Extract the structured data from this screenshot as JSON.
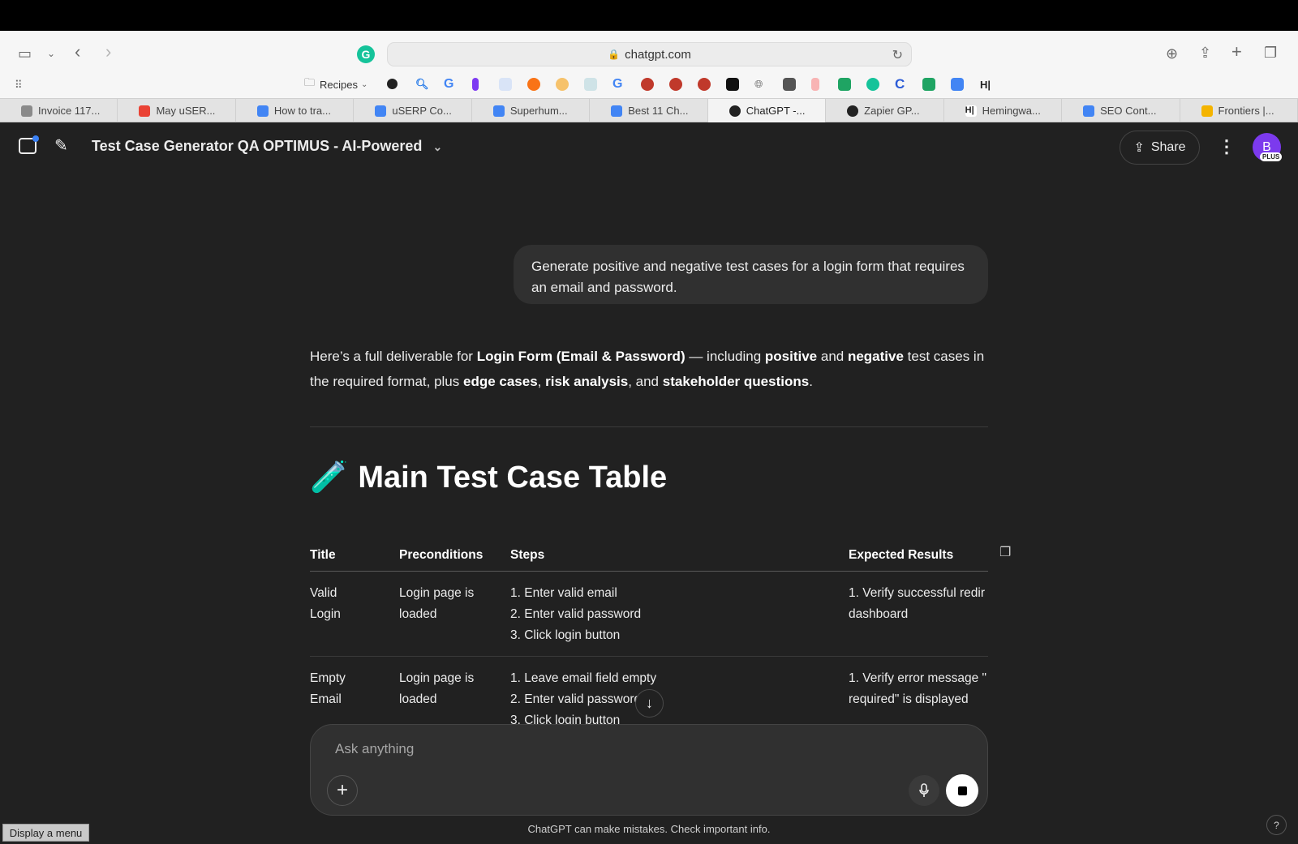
{
  "browser": {
    "url": "chatgpt.com",
    "bookmarks_folder": "Recipes",
    "tabs": [
      {
        "label": "Invoice 117...",
        "color": "#8a8a8a"
      },
      {
        "label": "May uSER...",
        "color": "#ea4335"
      },
      {
        "label": "How to tra...",
        "color": "#4285f4"
      },
      {
        "label": "uSERP Co...",
        "color": "#4285f4"
      },
      {
        "label": "Superhum...",
        "color": "#4285f4"
      },
      {
        "label": "Best 11 Ch...",
        "color": "#4285f4"
      },
      {
        "label": "ChatGPT -...",
        "color": "#222222"
      },
      {
        "label": "Zapier GP...",
        "color": "#222222"
      },
      {
        "label": "Hemingwa...",
        "color": "#222222"
      },
      {
        "label": "SEO Cont...",
        "color": "#4285f4"
      },
      {
        "label": "Frontiers |...",
        "color": "#f4b400"
      }
    ]
  },
  "header": {
    "title": "Test Case Generator QA OPTIMUS - AI-Powered",
    "share_label": "Share",
    "avatar_initial": "B",
    "plan_badge": "PLUS"
  },
  "conversation": {
    "user_message": "Generate positive and negative test cases for a login form that requires an email and password.",
    "intro": {
      "p1": "Here’s a full deliverable for ",
      "b1": "Login Form (Email & Password)",
      "p2": " — including ",
      "b2": "positive",
      "p3": " and ",
      "b3": "negative",
      "p4": " test cases in the required format, plus ",
      "b4": "edge cases",
      "p5": ", ",
      "b5": "risk analysis",
      "p6": ", and ",
      "b6": "stakeholder questions",
      "p7": "."
    },
    "section_emoji": "🧪",
    "section_title": "Main Test Case Table",
    "table": {
      "headers": [
        "Title",
        "Preconditions",
        "Steps",
        "Expected Results"
      ],
      "rows": [
        {
          "title_lines": [
            "Valid",
            "Login"
          ],
          "pre_lines": [
            "Login page is",
            "loaded"
          ],
          "steps": [
            "1. Enter valid email",
            "2. Enter valid password",
            "3. Click login button"
          ],
          "expected_lines": [
            "1. Verify successful redir",
            "dashboard"
          ]
        },
        {
          "title_lines": [
            "Empty",
            "Email"
          ],
          "pre_lines": [
            "Login page is",
            "loaded"
          ],
          "steps": [
            "1. Leave email field empty",
            "2. Enter valid password",
            "3. Click login button"
          ],
          "expected_lines": [
            "1. Verify error message \"",
            "required\" is displayed"
          ]
        }
      ]
    }
  },
  "composer": {
    "placeholder": "Ask anything"
  },
  "footer": {
    "disclaimer": "ChatGPT can make mistakes. Check important info.",
    "tooltip": "Display a menu",
    "help": "?"
  }
}
